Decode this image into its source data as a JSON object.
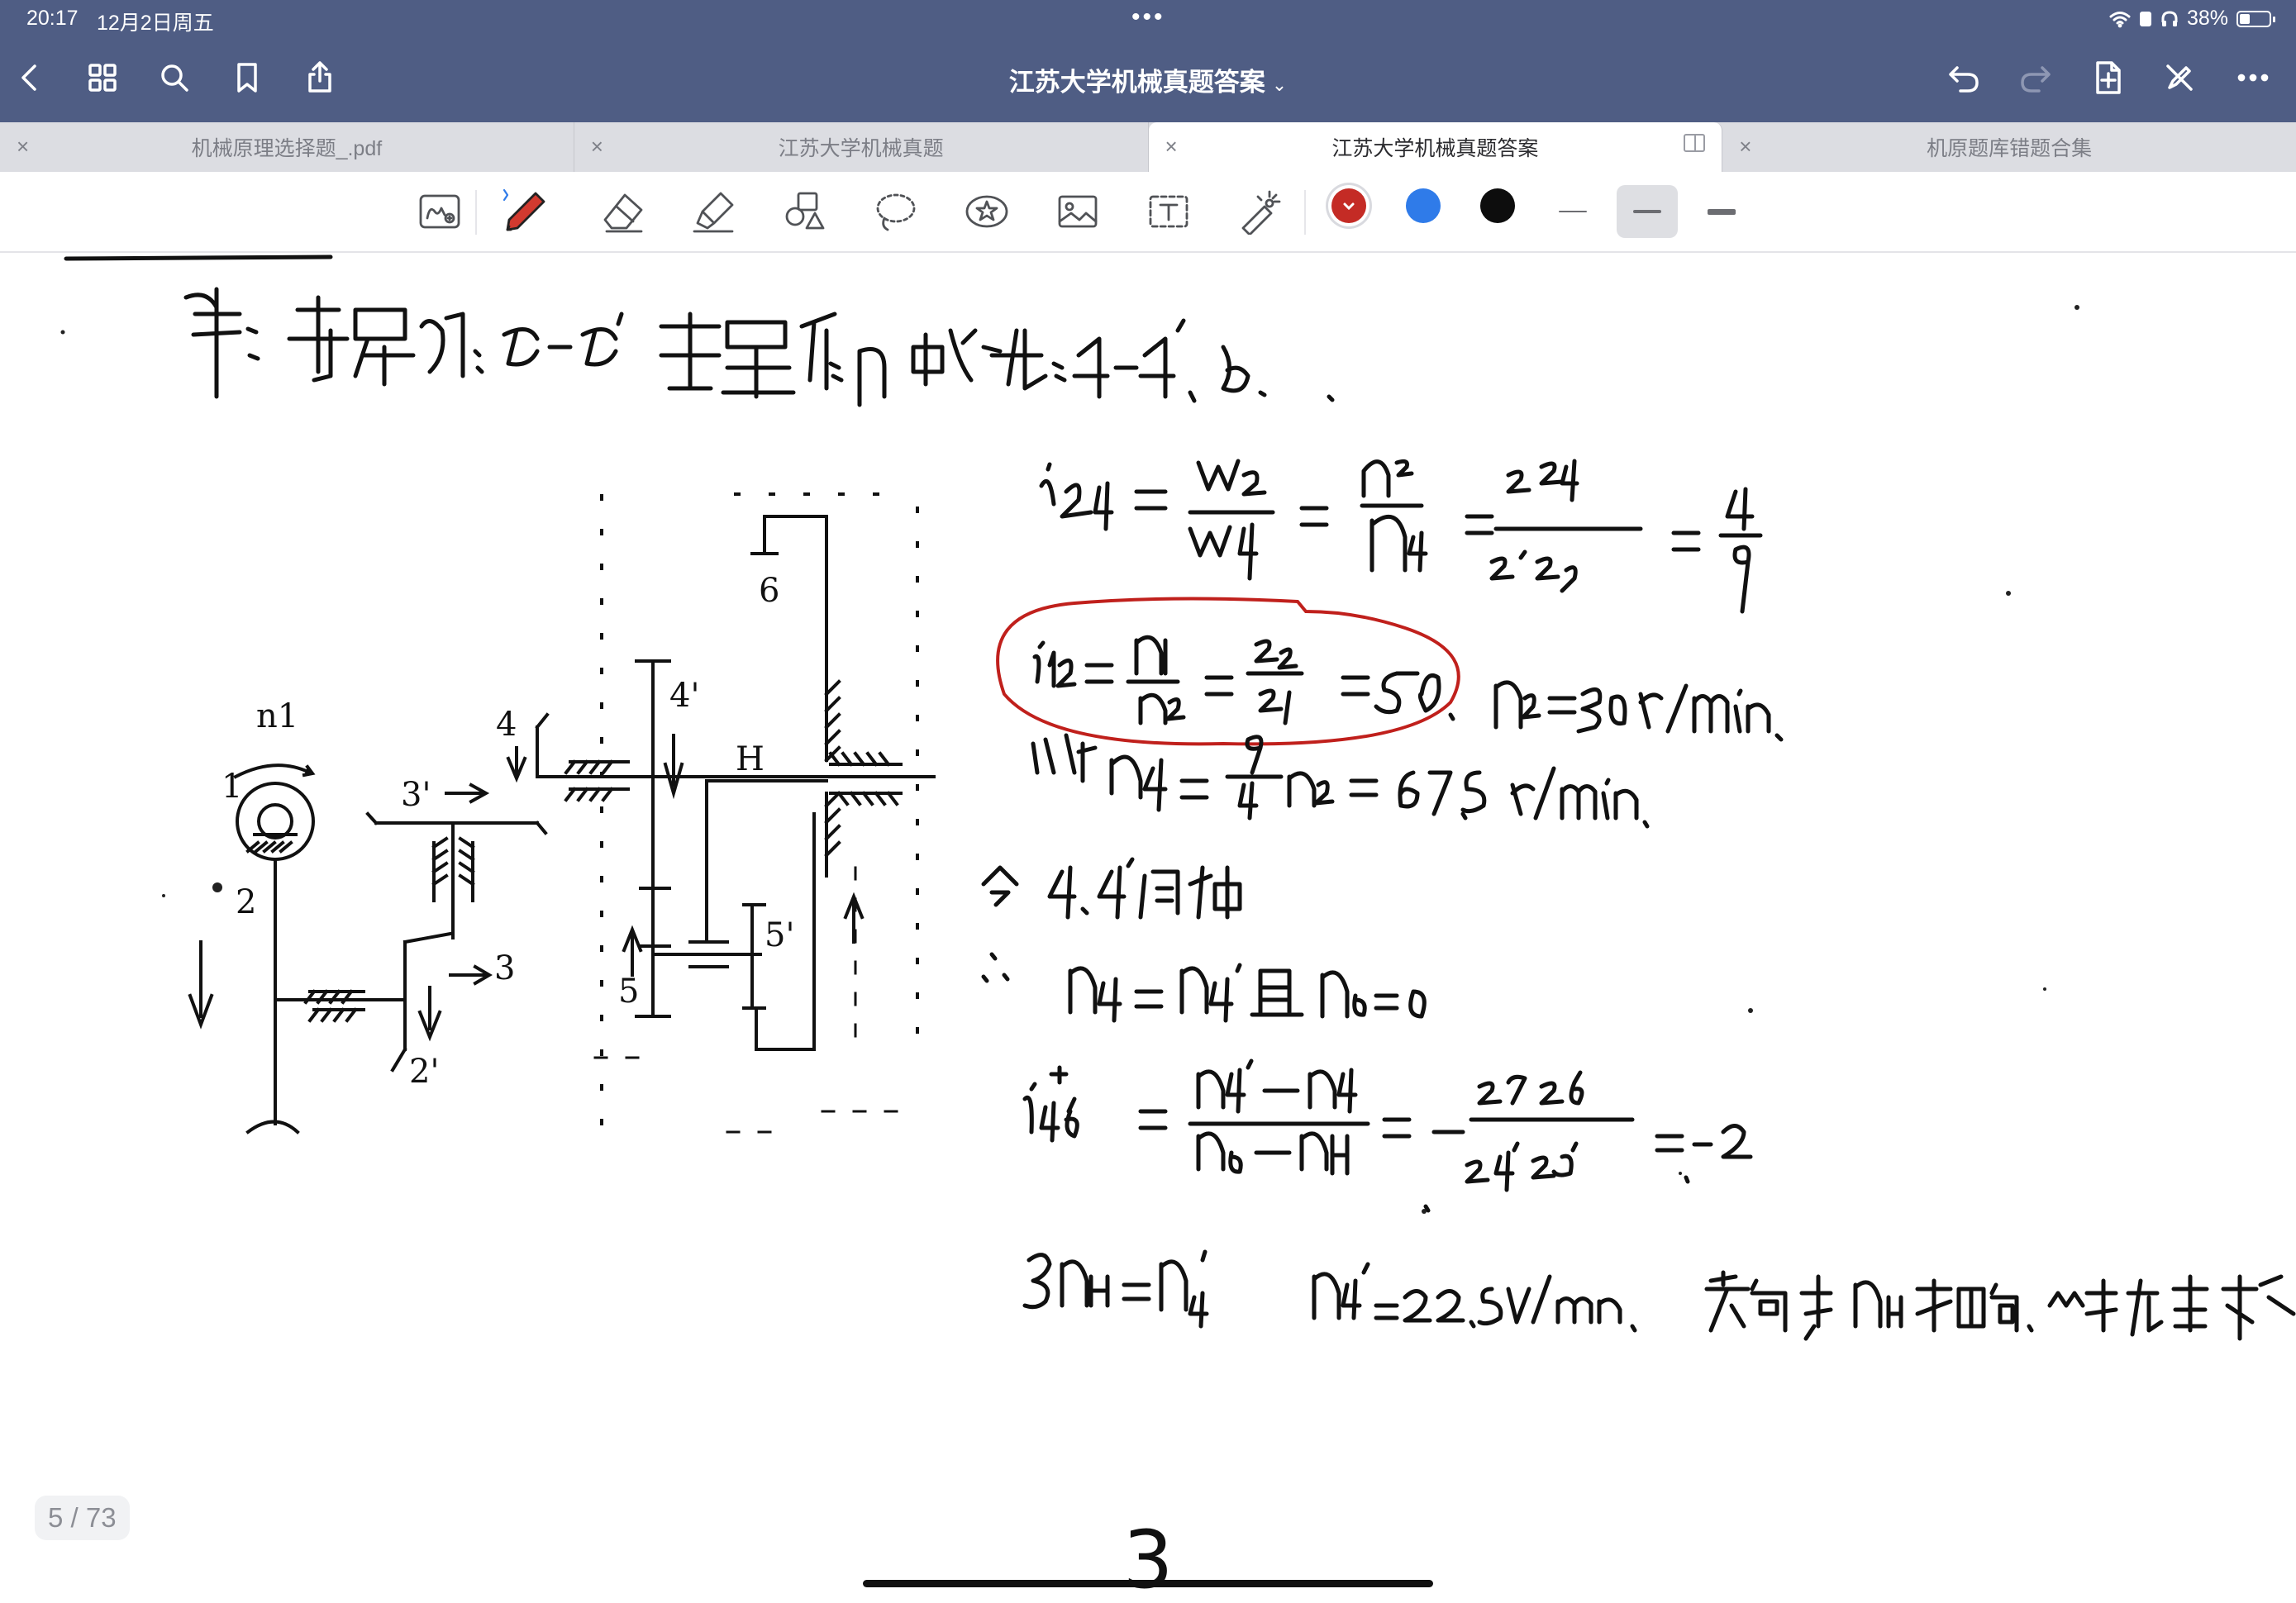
{
  "status_bar": {
    "time": "20:17",
    "date": "12月2日周五",
    "battery": "38%"
  },
  "header": {
    "title": "江苏大学机械真题答案"
  },
  "tabs": [
    {
      "label": "机械原理选择题_.pdf",
      "active": false
    },
    {
      "label": "江苏大学机械真题",
      "active": false
    },
    {
      "label": "江苏大学机械真题答案",
      "active": true
    },
    {
      "label": "机原题库错题合集",
      "active": false
    }
  ],
  "toolbar": {
    "tools": [
      "handwriting-to-text",
      "pen",
      "eraser",
      "highlighter",
      "shapes",
      "lasso",
      "elements",
      "image",
      "text",
      "laser-pointer"
    ],
    "colors": [
      "#c42b25",
      "#2f7be9",
      "#0d0d0d"
    ],
    "selected_color": "#c42b25",
    "selected_stroke": "medium"
  },
  "document": {
    "page_indicator": "5 / 73",
    "page_number": "3",
    "diagram_labels": [
      "n1",
      "1",
      "2",
      "2'",
      "3",
      "3'",
      "4",
      "4'",
      "5",
      "5'",
      "6",
      "H"
    ]
  }
}
